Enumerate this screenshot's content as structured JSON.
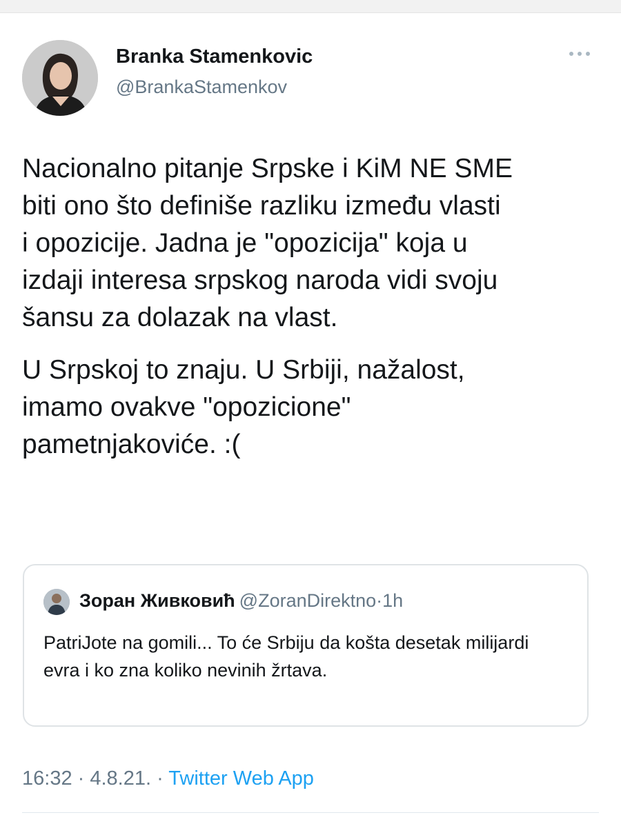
{
  "author": {
    "name": "Branka Stamenkovic",
    "handle": "@BrankaStamenkov",
    "avatar_icon": "profile-photo"
  },
  "more_icon": "more-horizontal-icon",
  "tweet": {
    "paragraphs": [
      "Nacionalno pitanje Srpske i KiM NE SME\nbiti ono što definiše razliku između vlasti\ni opozicije. Jadna je \"opozicija\" koja u\nizdaji interesa srpskog naroda vidi svoju\nšansu za dolazak na vlast.",
      "U Srpskoj to znaju. U Srbiji, nažalost,\nimamo ovakve \"opozicione\"\npametnjakoviće. :("
    ]
  },
  "quote": {
    "name": "Зоран Живковић",
    "handle": "@ZoranDirektno",
    "separator": "·",
    "time": "1h",
    "text": "PatriJote na gomili... To će Srbiju da košta desetak milijardi evra i ko zna koliko nevinih žrtava."
  },
  "meta": {
    "time": "16:32",
    "sep1": " · ",
    "date": "4.8.21.",
    "sep2": " · ",
    "source": "Twitter Web App"
  },
  "colors": {
    "text": "#14171a",
    "secondary": "#657786",
    "link": "#1da1f2",
    "border": "#dfe3e6"
  }
}
